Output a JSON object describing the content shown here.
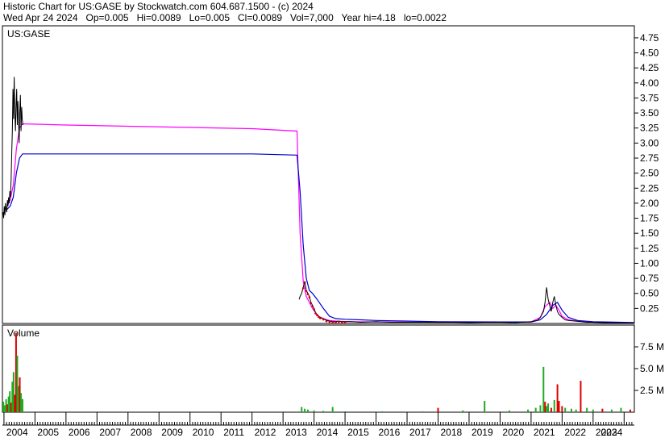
{
  "header": {
    "line1": "Historic Chart for US:GASE by Stockwatch.com 604.687.1500 - (c) 2024",
    "line2": "Wed Apr 24 2024   Op=0.005   Hi=0.0089   Lo=0.005   Cl=0.0089   Vol=7,000   Year hi=4.18   lo=0.0022"
  },
  "chart_data": {
    "type": "line",
    "symbol_label": "US:GASE",
    "volume_label": "Volume",
    "price_axis": {
      "ticks": [
        "4.75",
        "4.50",
        "4.25",
        "4.00",
        "3.75",
        "3.50",
        "3.25",
        "3.00",
        "2.75",
        "2.50",
        "2.25",
        "2.00",
        "1.75",
        "1.50",
        "1.25",
        "1.00",
        "0.75",
        "0.50",
        "0.25"
      ],
      "range": [
        0,
        4.95
      ]
    },
    "volume_axis": {
      "ticks": [
        "7.5 M",
        "5.0 M",
        "2.5 M"
      ],
      "tick_values": [
        7.5,
        5.0,
        2.5
      ],
      "range": [
        0,
        10
      ],
      "unit": "M"
    },
    "x_axis": {
      "ticks": [
        "2004",
        "2005",
        "2006",
        "2007",
        "2008",
        "2009",
        "2010",
        "2011",
        "2012",
        "2013",
        "2014",
        "2015",
        "2016",
        "2017",
        "2018",
        "2019",
        "2020",
        "2021",
        "2022",
        "2023",
        "2024"
      ],
      "range": [
        2003.95,
        2024.33
      ]
    },
    "colors": {
      "price": "#000000",
      "ma_short": "#ff00ff",
      "ma_long": "#0000cc",
      "up_volume": "#22aa22",
      "down_volume": "#dd0000",
      "close_dots": "#cc0000"
    },
    "series": [
      {
        "x": [
          2003.97,
          2003.99,
          2004.01,
          2004.03,
          2004.05,
          2004.07,
          2004.09,
          2004.11,
          2004.13,
          2004.15,
          2004.17,
          2004.19,
          2004.21,
          2004.23,
          2004.25,
          2004.27,
          2004.29,
          2004.31,
          2004.33,
          2004.35,
          2004.37,
          2004.39,
          2004.41,
          2004.43,
          2004.45,
          2004.47,
          2004.49,
          2004.51,
          2004.53,
          2004.55,
          2004.57,
          2004.59,
          2004.61
        ],
        "y": [
          1.85,
          1.75,
          1.95,
          1.8,
          2.0,
          1.9,
          1.85,
          2.05,
          1.95,
          2.1,
          2.0,
          2.2,
          2.1,
          2.4,
          2.8,
          3.2,
          3.9,
          3.4,
          4.1,
          3.5,
          3.2,
          3.6,
          3.9,
          3.3,
          3.7,
          3.4,
          3.0,
          3.5,
          3.8,
          3.2,
          3.6,
          3.4,
          3.3
        ]
      },
      {
        "x": [
          2013.52,
          2013.55,
          2013.6,
          2013.65,
          2013.7,
          2013.75,
          2013.8,
          2013.85,
          2013.9,
          2013.95,
          2014.0,
          2014.05,
          2014.1,
          2014.15,
          2014.2,
          2014.3,
          2014.4,
          2014.5,
          2014.6,
          2014.7,
          2014.8,
          2014.9,
          2015.0,
          2015.2,
          2015.5,
          2016.0,
          2016.5,
          2017.0,
          2017.5,
          2018.0,
          2018.5,
          2019.0,
          2019.5,
          2020.0,
          2020.5,
          2021.0,
          2021.2,
          2021.3,
          2021.4,
          2021.45,
          2021.5,
          2021.55,
          2021.6,
          2021.65,
          2021.7,
          2021.75,
          2021.8,
          2021.85,
          2021.9,
          2022.0,
          2022.1,
          2022.2,
          2022.4,
          2022.6,
          2022.8,
          2023.0,
          2023.3,
          2023.6,
          2023.9,
          2024.2,
          2024.31
        ],
        "y": [
          0.4,
          0.45,
          0.5,
          0.6,
          0.7,
          0.55,
          0.5,
          0.45,
          0.35,
          0.3,
          0.25,
          0.18,
          0.15,
          0.12,
          0.1,
          0.08,
          0.05,
          0.04,
          0.03,
          0.03,
          0.04,
          0.03,
          0.03,
          0.03,
          0.02,
          0.03,
          0.02,
          0.02,
          0.02,
          0.02,
          0.02,
          0.015,
          0.02,
          0.02,
          0.015,
          0.03,
          0.05,
          0.1,
          0.2,
          0.35,
          0.6,
          0.4,
          0.3,
          0.2,
          0.35,
          0.45,
          0.3,
          0.2,
          0.15,
          0.1,
          0.06,
          0.05,
          0.04,
          0.03,
          0.02,
          0.02,
          0.015,
          0.01,
          0.01,
          0.009,
          0.0089
        ]
      }
    ],
    "ma_short": {
      "x": [
        2004.1,
        2004.2,
        2004.3,
        2004.4,
        2004.5,
        2004.6,
        2006.0,
        2008.0,
        2010.0,
        2012.0,
        2013.45,
        2013.55,
        2013.65,
        2013.75,
        2013.85,
        2013.95,
        2014.05,
        2014.15,
        2014.3,
        2014.5,
        2014.8,
        2015.2,
        2016.0,
        2018.0,
        2020.0,
        2021.0,
        2021.3,
        2021.45,
        2021.6,
        2021.7,
        2021.8,
        2021.9,
        2022.0,
        2022.2,
        2022.5,
        2023.0,
        2024.31
      ],
      "y": [
        1.95,
        2.05,
        2.3,
        2.9,
        3.25,
        3.32,
        3.3,
        3.28,
        3.26,
        3.24,
        3.2,
        1.5,
        0.7,
        0.45,
        0.35,
        0.25,
        0.18,
        0.12,
        0.08,
        0.05,
        0.035,
        0.03,
        0.025,
        0.02,
        0.02,
        0.025,
        0.1,
        0.28,
        0.35,
        0.25,
        0.3,
        0.22,
        0.12,
        0.06,
        0.04,
        0.02,
        0.01
      ]
    },
    "ma_long": {
      "x": [
        2004.1,
        2004.2,
        2004.3,
        2004.4,
        2004.5,
        2004.6,
        2006.0,
        2008.0,
        2010.0,
        2012.0,
        2013.45,
        2013.55,
        2013.65,
        2013.75,
        2013.85,
        2013.95,
        2014.1,
        2014.3,
        2014.5,
        2014.7,
        2015.0,
        2015.5,
        2016.0,
        2018.0,
        2020.0,
        2021.0,
        2021.3,
        2021.5,
        2021.7,
        2021.85,
        2022.0,
        2022.2,
        2022.5,
        2023.0,
        2024.31
      ],
      "y": [
        1.9,
        1.95,
        2.1,
        2.5,
        2.75,
        2.82,
        2.82,
        2.82,
        2.82,
        2.82,
        2.8,
        2.2,
        1.3,
        0.75,
        0.55,
        0.5,
        0.4,
        0.25,
        0.12,
        0.08,
        0.07,
        0.06,
        0.05,
        0.03,
        0.025,
        0.025,
        0.06,
        0.15,
        0.3,
        0.35,
        0.22,
        0.1,
        0.05,
        0.03,
        0.015
      ]
    },
    "volume": [
      {
        "x": 2003.98,
        "v": 1.2,
        "dir": "up"
      },
      {
        "x": 2004.03,
        "v": 0.8,
        "dir": "up"
      },
      {
        "x": 2004.07,
        "v": 1.5,
        "dir": "up"
      },
      {
        "x": 2004.11,
        "v": 0.9,
        "dir": "down"
      },
      {
        "x": 2004.15,
        "v": 1.8,
        "dir": "up"
      },
      {
        "x": 2004.19,
        "v": 2.4,
        "dir": "up"
      },
      {
        "x": 2004.23,
        "v": 1.1,
        "dir": "down"
      },
      {
        "x": 2004.27,
        "v": 3.5,
        "dir": "up"
      },
      {
        "x": 2004.31,
        "v": 4.6,
        "dir": "up"
      },
      {
        "x": 2004.35,
        "v": 2.0,
        "dir": "down"
      },
      {
        "x": 2004.39,
        "v": 9.1,
        "dir": "down"
      },
      {
        "x": 2004.43,
        "v": 6.5,
        "dir": "up"
      },
      {
        "x": 2004.47,
        "v": 3.0,
        "dir": "up"
      },
      {
        "x": 2004.51,
        "v": 4.0,
        "dir": "down"
      },
      {
        "x": 2004.55,
        "v": 2.2,
        "dir": "up"
      },
      {
        "x": 2004.6,
        "v": 1.5,
        "dir": "up"
      },
      {
        "x": 2013.6,
        "v": 0.6,
        "dir": "up"
      },
      {
        "x": 2013.7,
        "v": 0.4,
        "dir": "up"
      },
      {
        "x": 2013.8,
        "v": 0.3,
        "dir": "up"
      },
      {
        "x": 2014.0,
        "v": 0.2,
        "dir": "up"
      },
      {
        "x": 2014.3,
        "v": 0.15,
        "dir": "up"
      },
      {
        "x": 2014.6,
        "v": 0.6,
        "dir": "up"
      },
      {
        "x": 2015.0,
        "v": 0.1,
        "dir": "up"
      },
      {
        "x": 2016.2,
        "v": 0.1,
        "dir": "up"
      },
      {
        "x": 2017.5,
        "v": 0.1,
        "dir": "up"
      },
      {
        "x": 2018.0,
        "v": 0.5,
        "dir": "down"
      },
      {
        "x": 2018.8,
        "v": 0.2,
        "dir": "up"
      },
      {
        "x": 2019.5,
        "v": 1.3,
        "dir": "up"
      },
      {
        "x": 2020.3,
        "v": 0.2,
        "dir": "up"
      },
      {
        "x": 2020.9,
        "v": 0.3,
        "dir": "up"
      },
      {
        "x": 2021.15,
        "v": 0.5,
        "dir": "up"
      },
      {
        "x": 2021.3,
        "v": 0.8,
        "dir": "up"
      },
      {
        "x": 2021.4,
        "v": 5.2,
        "dir": "up"
      },
      {
        "x": 2021.45,
        "v": 1.2,
        "dir": "down"
      },
      {
        "x": 2021.5,
        "v": 0.7,
        "dir": "up"
      },
      {
        "x": 2021.55,
        "v": 1.0,
        "dir": "up"
      },
      {
        "x": 2021.65,
        "v": 0.5,
        "dir": "down"
      },
      {
        "x": 2021.75,
        "v": 1.4,
        "dir": "up"
      },
      {
        "x": 2021.85,
        "v": 3.2,
        "dir": "down"
      },
      {
        "x": 2021.9,
        "v": 1.3,
        "dir": "down"
      },
      {
        "x": 2022.0,
        "v": 0.7,
        "dir": "down"
      },
      {
        "x": 2022.1,
        "v": 0.5,
        "dir": "up"
      },
      {
        "x": 2022.3,
        "v": 0.4,
        "dir": "up"
      },
      {
        "x": 2022.45,
        "v": 0.3,
        "dir": "up"
      },
      {
        "x": 2022.6,
        "v": 3.6,
        "dir": "down"
      },
      {
        "x": 2022.8,
        "v": 0.5,
        "dir": "up"
      },
      {
        "x": 2023.0,
        "v": 0.3,
        "dir": "up"
      },
      {
        "x": 2023.3,
        "v": 0.4,
        "dir": "down"
      },
      {
        "x": 2023.6,
        "v": 0.3,
        "dir": "up"
      },
      {
        "x": 2023.9,
        "v": 0.5,
        "dir": "up"
      },
      {
        "x": 2024.2,
        "v": 0.3,
        "dir": "down"
      }
    ],
    "grid": false
  }
}
